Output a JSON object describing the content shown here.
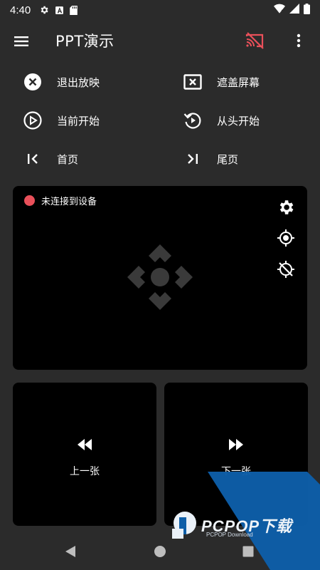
{
  "status_bar": {
    "time": "4:40"
  },
  "app_bar": {
    "title": "PPT演示"
  },
  "actions": {
    "exit_show": "退出放映",
    "cover_screen": "遮盖屏幕",
    "from_current": "当前开始",
    "from_start": "从头开始",
    "first_page": "首页",
    "last_page": "尾页"
  },
  "pad": {
    "connection_status": "未连接到设备",
    "status_color": "#e9505a"
  },
  "nav": {
    "prev_label": "上一张",
    "next_label": "下一张"
  },
  "watermark": {
    "brand": "PCPOP下载",
    "sub": "PCPOP Download"
  },
  "colors": {
    "background": "#2b2b2b",
    "panel": "#000000",
    "accent": "#e9505a",
    "watermark_blue": "#0d5ea8"
  }
}
